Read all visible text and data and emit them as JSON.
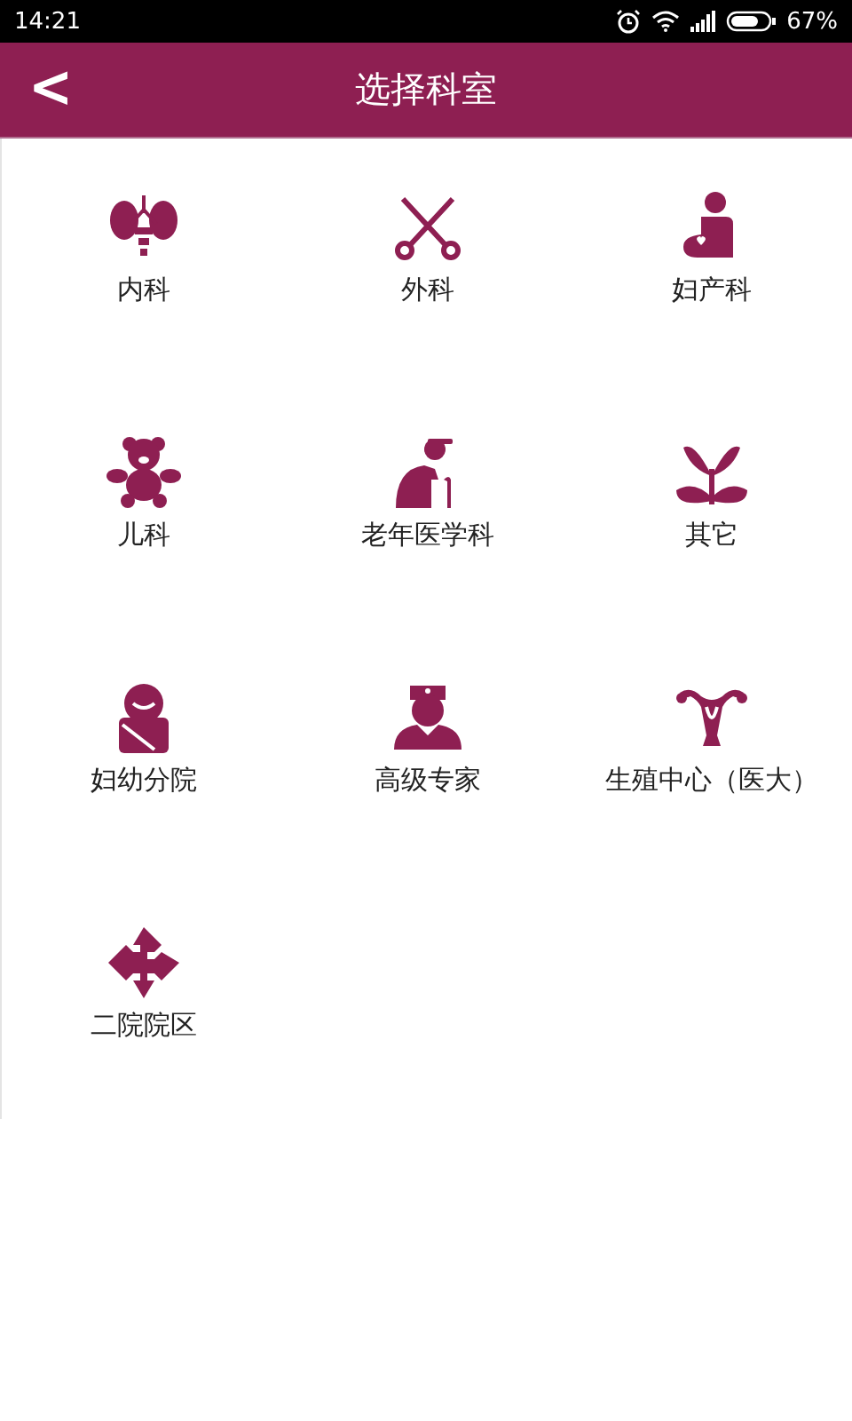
{
  "status_bar": {
    "time": "14:21",
    "battery_text": "67%"
  },
  "header": {
    "back": "<",
    "title": "选择科室"
  },
  "departments": [
    {
      "kind": "organs",
      "label": "内科"
    },
    {
      "kind": "scissors",
      "label": "外科"
    },
    {
      "kind": "pregnant",
      "label": "妇产科"
    },
    {
      "kind": "bear",
      "label": "儿科"
    },
    {
      "kind": "elder",
      "label": "老年医学科"
    },
    {
      "kind": "sprout",
      "label": "其它"
    },
    {
      "kind": "baby",
      "label": "妇幼分院"
    },
    {
      "kind": "doctor",
      "label": "高级专家"
    },
    {
      "kind": "uterus",
      "label": "生殖中心（医大）"
    },
    {
      "kind": "cross",
      "label": "二院院区"
    }
  ]
}
